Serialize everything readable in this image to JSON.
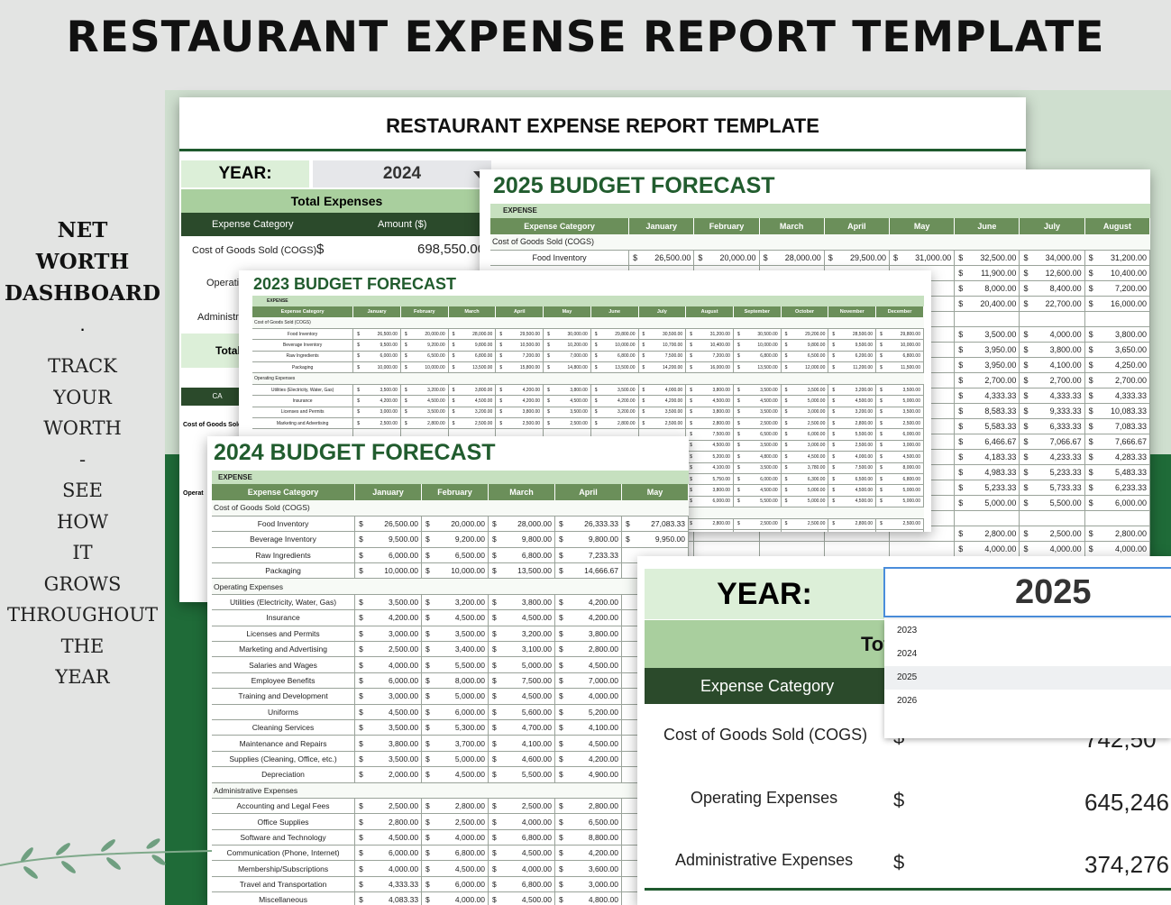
{
  "page_title": "RESTAURANT EXPENSE REPORT TEMPLATE",
  "side": {
    "heading_lines": [
      "NET",
      "WORTH",
      "DASHBOARD"
    ],
    "dot": ".",
    "text_lines": [
      "TRACK",
      "YOUR",
      "WORTH",
      "-",
      "SEE",
      "HOW",
      "IT",
      "GROWS",
      "THROUGHOUT",
      "THE",
      "YEAR"
    ]
  },
  "report": {
    "title": "RESTAURANT EXPENSE REPORT TEMPLATE",
    "year_label": "YEAR:",
    "year_value": "2024",
    "total_expenses": "Total Expenses",
    "col_category": "Expense Category",
    "col_amount": "Amount ($)",
    "rows": [
      {
        "label": "Cost of Goods Sold (COGS)",
        "currency": "$",
        "amount": "698,550.00"
      },
      {
        "label": "Operatin",
        "currency": "",
        "amount": ""
      },
      {
        "label": "Administra",
        "currency": "",
        "amount": ""
      }
    ],
    "total_label": "Total",
    "cat_label_2": "CA",
    "cogs_label_small": "Cost of Goods Sold",
    "oper_label_small": "Operat"
  },
  "forecast_2025": {
    "title": "2025 BUDGET FORECAST",
    "section": "EXPENSE",
    "columns": [
      "Expense Category",
      "January",
      "February",
      "March",
      "April",
      "May",
      "June",
      "July",
      "August"
    ],
    "group": "Cost of Goods Sold (COGS)",
    "rows": [
      {
        "label": "Food Inventory",
        "values": [
          "26,500.00",
          "20,000.00",
          "28,000.00",
          "29,500.00",
          "31,000.00",
          "32,500.00",
          "34,000.00",
          "31,200.00"
        ]
      },
      {
        "label": "",
        "values": [
          "",
          "",
          "",
          "",
          "",
          "11,900.00",
          "12,600.00",
          "10,400.00"
        ]
      },
      {
        "label": "",
        "values": [
          "",
          "",
          "",
          "",
          "",
          "8,000.00",
          "8,400.00",
          "7,200.00"
        ]
      },
      {
        "label": "",
        "values": [
          "",
          "",
          "",
          "",
          "",
          "20,400.00",
          "22,700.00",
          "16,000.00"
        ]
      },
      {
        "label": "",
        "values": [
          "",
          "",
          "",
          "",
          "",
          "",
          "",
          ""
        ]
      },
      {
        "label": "",
        "values": [
          "",
          "",
          "",
          "",
          "",
          "3,500.00",
          "4,000.00",
          "3,800.00"
        ]
      },
      {
        "label": "",
        "values": [
          "",
          "",
          "",
          "",
          "",
          "3,950.00",
          "3,800.00",
          "3,650.00"
        ]
      },
      {
        "label": "",
        "values": [
          "",
          "",
          "",
          "",
          "",
          "3,950.00",
          "4,100.00",
          "4,250.00"
        ]
      },
      {
        "label": "",
        "values": [
          "",
          "",
          "",
          "",
          "",
          "2,700.00",
          "2,700.00",
          "2,700.00"
        ]
      },
      {
        "label": "",
        "values": [
          "",
          "",
          "",
          "",
          "",
          "4,333.33",
          "4,333.33",
          "4,333.33"
        ]
      },
      {
        "label": "",
        "values": [
          "",
          "",
          "",
          "",
          "",
          "8,583.33",
          "9,333.33",
          "10,083.33"
        ]
      },
      {
        "label": "",
        "values": [
          "",
          "",
          "",
          "",
          "",
          "5,583.33",
          "6,333.33",
          "7,083.33"
        ]
      },
      {
        "label": "",
        "values": [
          "",
          "",
          "",
          "",
          "",
          "6,466.67",
          "7,066.67",
          "7,666.67"
        ]
      },
      {
        "label": "",
        "values": [
          "",
          "",
          "",
          "",
          "",
          "4,183.33",
          "4,233.33",
          "4,283.33"
        ]
      },
      {
        "label": "",
        "values": [
          "",
          "",
          "",
          "",
          "",
          "4,983.33",
          "5,233.33",
          "5,483.33"
        ]
      },
      {
        "label": "",
        "values": [
          "",
          "",
          "",
          "",
          "",
          "5,233.33",
          "5,733.33",
          "6,233.33"
        ]
      },
      {
        "label": "",
        "values": [
          "",
          "",
          "",
          "",
          "",
          "5,000.00",
          "5,500.00",
          "6,000.00"
        ]
      },
      {
        "label": "",
        "values": [
          "",
          "",
          "",
          "",
          "",
          "",
          "",
          ""
        ]
      },
      {
        "label": "",
        "values": [
          "",
          "",
          "",
          "",
          "",
          "2,800.00",
          "2,500.00",
          "2,800.00"
        ]
      },
      {
        "label": "",
        "values": [
          "",
          "",
          "",
          "",
          "",
          "4,000.00",
          "4,000.00",
          "4,000.00"
        ]
      }
    ]
  },
  "forecast_2023": {
    "title": "2023 BUDGET FORECAST",
    "section": "EXPENSE",
    "columns": [
      "Expense Category",
      "January",
      "February",
      "March",
      "April",
      "May",
      "June",
      "July",
      "August",
      "September",
      "October",
      "November",
      "December"
    ],
    "rows": [
      {
        "type": "section",
        "label": "Cost of Goods Sold (COGS)"
      },
      {
        "label": "Food Inventory",
        "values": [
          "26,500.00",
          "20,000.00",
          "28,000.00",
          "29,500.00",
          "30,000.00",
          "29,800.00",
          "30,500.00",
          "31,200.00",
          "30,500.00",
          "29,200.00",
          "28,500.00",
          "29,800.00"
        ]
      },
      {
        "label": "Beverage Inventory",
        "values": [
          "9,500.00",
          "9,200.00",
          "9,800.00",
          "10,500.00",
          "10,200.00",
          "10,000.00",
          "10,700.00",
          "10,400.00",
          "10,000.00",
          "9,800.00",
          "9,500.00",
          "10,000.00"
        ]
      },
      {
        "label": "Raw Ingredients",
        "values": [
          "6,000.00",
          "6,500.00",
          "6,800.00",
          "7,200.00",
          "7,000.00",
          "6,800.00",
          "7,500.00",
          "7,200.00",
          "6,800.00",
          "6,500.00",
          "6,200.00",
          "6,800.00"
        ]
      },
      {
        "label": "Packaging",
        "values": [
          "10,000.00",
          "10,000.00",
          "13,500.00",
          "15,800.00",
          "14,800.00",
          "13,500.00",
          "14,200.00",
          "16,000.00",
          "13,500.00",
          "12,000.00",
          "11,200.00",
          "11,500.00"
        ]
      },
      {
        "type": "section",
        "label": "Operating Expenses"
      },
      {
        "label": "Utilities (Electricity, Water, Gas)",
        "values": [
          "3,500.00",
          "3,200.00",
          "3,800.00",
          "4,200.00",
          "3,800.00",
          "3,500.00",
          "4,000.00",
          "3,800.00",
          "3,500.00",
          "3,500.00",
          "3,200.00",
          "3,500.00"
        ]
      },
      {
        "label": "Insurance",
        "values": [
          "4,200.00",
          "4,500.00",
          "4,500.00",
          "4,200.00",
          "4,500.00",
          "4,200.00",
          "4,200.00",
          "4,500.00",
          "4,500.00",
          "5,000.00",
          "4,500.00",
          "5,000.00"
        ]
      },
      {
        "label": "Licenses and Permits",
        "values": [
          "3,000.00",
          "3,500.00",
          "3,200.00",
          "3,800.00",
          "3,500.00",
          "3,200.00",
          "3,500.00",
          "3,800.00",
          "3,500.00",
          "3,000.00",
          "3,200.00",
          "3,500.00"
        ]
      },
      {
        "label": "Marketing and Advertising",
        "values": [
          "2,500.00",
          "2,800.00",
          "2,500.00",
          "2,500.00",
          "2,500.00",
          "2,800.00",
          "2,500.00",
          "2,800.00",
          "2,500.00",
          "2,500.00",
          "2,800.00",
          "2,500.00"
        ]
      },
      {
        "label": "",
        "values": [
          "",
          "",
          "",
          "",
          "",
          "",
          "",
          "7,500.00",
          "6,500.00",
          "6,000.00",
          "5,500.00",
          "6,000.00"
        ]
      },
      {
        "label": "",
        "values": [
          "",
          "",
          "",
          "",
          "",
          "",
          "",
          "4,500.00",
          "3,500.00",
          "3,000.00",
          "2,500.00",
          "3,000.00"
        ]
      },
      {
        "label": "",
        "values": [
          "",
          "",
          "",
          "",
          "",
          "",
          "",
          "5,200.00",
          "4,800.00",
          "4,500.00",
          "4,000.00",
          "4,500.00"
        ]
      },
      {
        "label": "",
        "values": [
          "",
          "",
          "",
          "",
          "",
          "",
          "",
          "4,100.00",
          "3,500.00",
          "3,780.00",
          "7,500.00",
          "8,000.00"
        ]
      },
      {
        "label": "",
        "values": [
          "",
          "",
          "",
          "",
          "",
          "",
          "",
          "5,750.00",
          "6,000.00",
          "6,300.00",
          "6,500.00",
          "6,800.00"
        ]
      },
      {
        "label": "",
        "values": [
          "",
          "",
          "",
          "",
          "",
          "",
          "",
          "3,800.00",
          "4,500.00",
          "5,000.00",
          "4,500.00",
          "5,000.00"
        ]
      },
      {
        "label": "",
        "values": [
          "",
          "",
          "",
          "",
          "",
          "",
          "",
          "6,000.00",
          "5,500.00",
          "5,000.00",
          "4,500.00",
          "5,000.00"
        ]
      },
      {
        "type": "section",
        "label": ""
      },
      {
        "label": "",
        "values": [
          "",
          "",
          "",
          "",
          "",
          "",
          "",
          "2,800.00",
          "2,500.00",
          "2,500.00",
          "2,800.00",
          "2,500.00"
        ]
      },
      {
        "label": "",
        "values": [
          "",
          "",
          "",
          "",
          "",
          "",
          "",
          "4,500.00",
          "4,000.00",
          "4,000.00",
          "4,500.00",
          "4,000.00"
        ]
      }
    ]
  },
  "forecast_2024": {
    "title": "2024 BUDGET FORECAST",
    "section": "EXPENSE",
    "columns": [
      "Expense Category",
      "January",
      "February",
      "March",
      "April",
      "May"
    ],
    "rows": [
      {
        "type": "section",
        "label": "Cost of Goods Sold (COGS)"
      },
      {
        "label": "Food Inventory",
        "values": [
          "26,500.00",
          "20,000.00",
          "28,000.00",
          "26,333.33",
          "27,083.33"
        ]
      },
      {
        "label": "Beverage Inventory",
        "values": [
          "9,500.00",
          "9,200.00",
          "9,800.00",
          "9,800.00",
          "9,950.00"
        ]
      },
      {
        "label": "Raw Ingredients",
        "values": [
          "6,000.00",
          "6,500.00",
          "6,800.00",
          "7,233.33",
          ""
        ]
      },
      {
        "label": "Packaging",
        "values": [
          "10,000.00",
          "10,000.00",
          "13,500.00",
          "14,666.67",
          ""
        ]
      },
      {
        "type": "section",
        "label": "Operating Expenses"
      },
      {
        "label": "Utilities (Electricity, Water, Gas)",
        "values": [
          "3,500.00",
          "3,200.00",
          "3,800.00",
          "4,200.00",
          ""
        ]
      },
      {
        "label": "Insurance",
        "values": [
          "4,200.00",
          "4,500.00",
          "4,500.00",
          "4,200.00",
          ""
        ]
      },
      {
        "label": "Licenses and Permits",
        "values": [
          "3,000.00",
          "3,500.00",
          "3,200.00",
          "3,800.00",
          ""
        ]
      },
      {
        "label": "Marketing and Advertising",
        "values": [
          "2,500.00",
          "3,400.00",
          "3,100.00",
          "2,800.00",
          ""
        ]
      },
      {
        "label": "Salaries and Wages",
        "values": [
          "4,000.00",
          "5,500.00",
          "5,000.00",
          "4,500.00",
          ""
        ]
      },
      {
        "label": "Employee Benefits",
        "values": [
          "6,000.00",
          "8,000.00",
          "7,500.00",
          "7,000.00",
          ""
        ]
      },
      {
        "label": "Training and Development",
        "values": [
          "3,000.00",
          "5,000.00",
          "4,500.00",
          "4,000.00",
          ""
        ]
      },
      {
        "label": "Uniforms",
        "values": [
          "4,500.00",
          "6,000.00",
          "5,600.00",
          "5,200.00",
          ""
        ]
      },
      {
        "label": "Cleaning Services",
        "values": [
          "3,500.00",
          "5,300.00",
          "4,700.00",
          "4,100.00",
          ""
        ]
      },
      {
        "label": "Maintenance and Repairs",
        "values": [
          "3,800.00",
          "3,700.00",
          "4,100.00",
          "4,500.00",
          ""
        ]
      },
      {
        "label": "Supplies (Cleaning, Office, etc.)",
        "values": [
          "3,500.00",
          "5,000.00",
          "4,600.00",
          "4,200.00",
          ""
        ]
      },
      {
        "label": "Depreciation",
        "values": [
          "2,000.00",
          "4,500.00",
          "5,500.00",
          "4,900.00",
          ""
        ]
      },
      {
        "type": "section",
        "label": "Administrative Expenses"
      },
      {
        "label": "Accounting and Legal Fees",
        "values": [
          "2,500.00",
          "2,800.00",
          "2,500.00",
          "2,800.00",
          ""
        ]
      },
      {
        "label": "Office Supplies",
        "values": [
          "2,800.00",
          "2,500.00",
          "4,000.00",
          "6,500.00",
          ""
        ]
      },
      {
        "label": "Software and Technology",
        "values": [
          "4,500.00",
          "4,000.00",
          "6,800.00",
          "8,800.00",
          ""
        ]
      },
      {
        "label": "Communication (Phone, Internet)",
        "values": [
          "6,000.00",
          "6,800.00",
          "4,500.00",
          "4,200.00",
          ""
        ]
      },
      {
        "label": "Membership/Subscriptions",
        "values": [
          "4,000.00",
          "4,500.00",
          "4,000.00",
          "3,600.00",
          ""
        ]
      },
      {
        "label": "Travel and Transportation",
        "values": [
          "4,333.33",
          "6,000.00",
          "6,800.00",
          "3,000.00",
          ""
        ]
      },
      {
        "label": "Miscellaneous",
        "values": [
          "4,083.33",
          "4,000.00",
          "4,500.00",
          "4,800.00",
          ""
        ]
      }
    ]
  },
  "zoom": {
    "year_label": "YEAR:",
    "year_value": "2025",
    "total_partial": "Tot",
    "col_category": "Expense Category",
    "dropdown_options": [
      "2023",
      "2024",
      "2025",
      "2026"
    ],
    "dropdown_highlighted": "2025",
    "rows": [
      {
        "label": "Cost of Goods Sold (COGS)",
        "currency": "$",
        "amount": "742,50"
      },
      {
        "label": "Operating Expenses",
        "currency": "$",
        "amount": "645,246"
      },
      {
        "label": "Administrative Expenses",
        "currency": "$",
        "amount": "374,276"
      }
    ]
  },
  "colors": {
    "accent_green": "#215c2e",
    "header_green": "#6b8f5a",
    "light_green": "#dcefd8",
    "dark_green": "#2b4a2b",
    "background_green": "#1f6b38"
  }
}
